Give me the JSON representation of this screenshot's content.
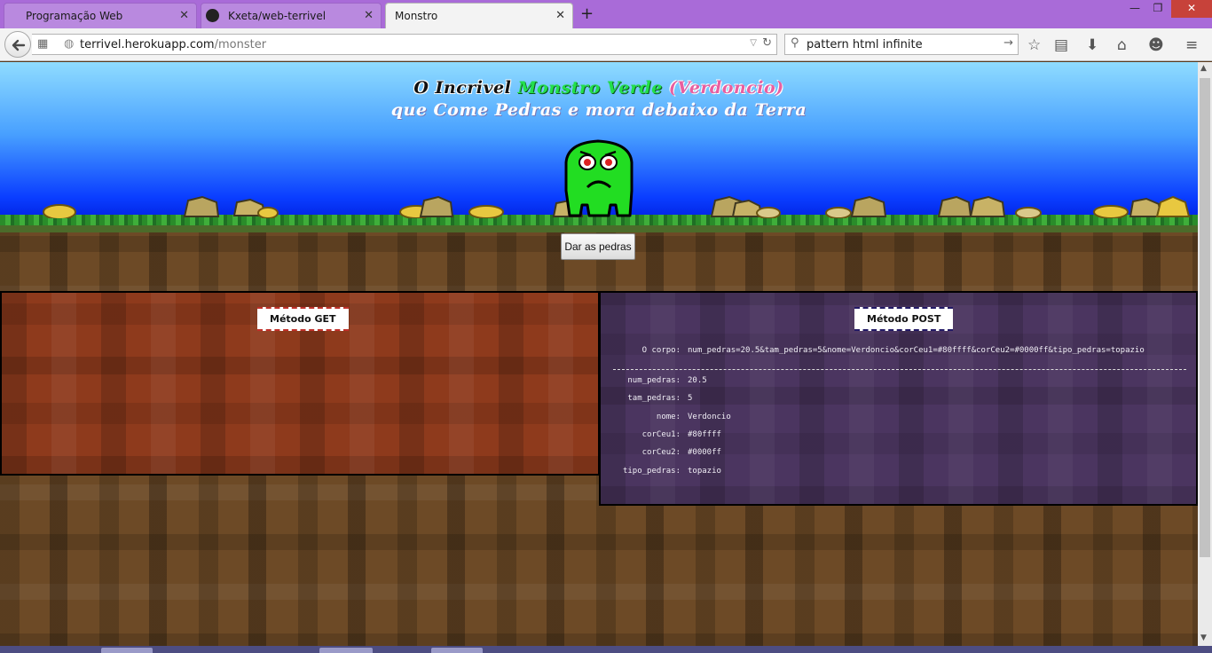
{
  "browser": {
    "tabs": [
      {
        "label": "Programação Web",
        "active": false
      },
      {
        "label": "Kxeta/web-terrivel",
        "active": false
      },
      {
        "label": "Monstro",
        "active": true
      }
    ],
    "url_host": "terrivel.herokuapp.com",
    "url_path": "/monster",
    "search_text": "pattern html infinite"
  },
  "page": {
    "title_part1": "O Incrivel ",
    "title_part2": "Monstro Verde ",
    "title_part3": "(Verdoncio)",
    "subtitle": "que Come Pedras e mora debaixo da Terra",
    "button_label": "Dar as pedras"
  },
  "get_panel": {
    "heading": "Método GET"
  },
  "post_panel": {
    "heading": "Método POST",
    "body_label": "O corpo:",
    "body_value": "num_pedras=20.5&tam_pedras=5&nome=Verdoncio&corCeu1=#80ffff&corCeu2=#0000ff&tipo_pedras=topazio",
    "fields": [
      {
        "key": "num_pedras:",
        "value": "20.5"
      },
      {
        "key": "tam_pedras:",
        "value": "5"
      },
      {
        "key": "nome:",
        "value": "Verdoncio"
      },
      {
        "key": "corCeu1:",
        "value": "#80ffff"
      },
      {
        "key": "corCeu2:",
        "value": "#0000ff"
      },
      {
        "key": "tipo_pedras:",
        "value": "topazio"
      }
    ]
  },
  "colors": {
    "sky_top": "#80ffff",
    "sky_bottom": "#0000ff",
    "monster": "#22dd22",
    "stone": "#e8c840"
  }
}
